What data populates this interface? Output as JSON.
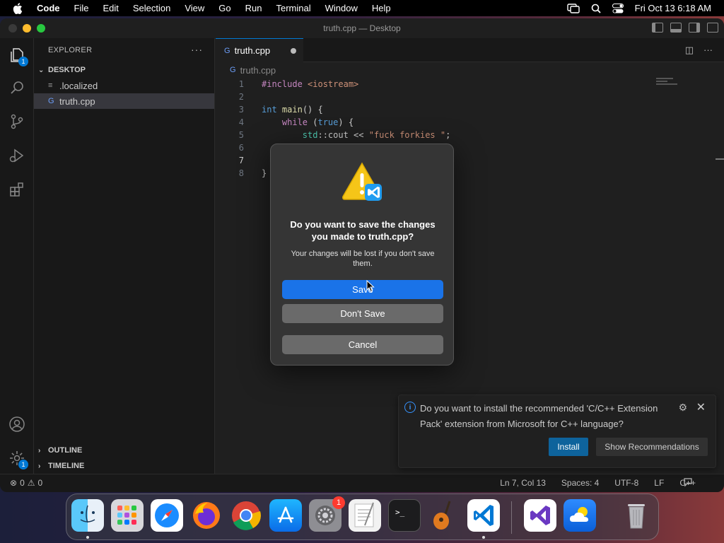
{
  "menubar": {
    "app_name": "Code",
    "items": [
      "File",
      "Edit",
      "Selection",
      "View",
      "Go",
      "Run",
      "Terminal",
      "Window",
      "Help"
    ],
    "clock": "Fri Oct 13  6:18 AM"
  },
  "window": {
    "title": "truth.cpp — Desktop"
  },
  "activity": {
    "explorer_badge": "1",
    "manage_badge": "1"
  },
  "sidebar": {
    "header": "EXPLORER",
    "folder": "DESKTOP",
    "files": [
      ".localized",
      "truth.cpp"
    ],
    "outline": "OUTLINE",
    "timeline": "TIMELINE"
  },
  "editor": {
    "tab_label": "truth.cpp",
    "breadcrumb": "truth.cpp",
    "lines": [
      {
        "n": "1",
        "code": "#include <iostream>"
      },
      {
        "n": "2",
        "code": ""
      },
      {
        "n": "3",
        "code": "int main() {"
      },
      {
        "n": "4",
        "code": "    while (true) {"
      },
      {
        "n": "5",
        "code": "        std::cout << \"fuck forkies \";"
      },
      {
        "n": "6",
        "code": ""
      },
      {
        "n": "7",
        "code": ""
      },
      {
        "n": "8",
        "code": "}"
      }
    ]
  },
  "dialog": {
    "title": "Do you want to save the changes you made to truth.cpp?",
    "subtitle": "Your changes will be lost if you don't save them.",
    "save": "Save",
    "dont_save": "Don't Save",
    "cancel": "Cancel"
  },
  "toast": {
    "message": "Do you want to install the recommended 'C/C++ Extension Pack' extension from Microsoft for C++ language?",
    "install": "Install",
    "show_recommendations": "Show Recommendations"
  },
  "statusbar": {
    "errors": "0",
    "warnings": "0",
    "position": "Ln 7, Col 13",
    "spaces": "Spaces: 4",
    "encoding": "UTF-8",
    "eol": "LF",
    "language": "C++"
  },
  "dock": {
    "system_settings_badge": "1"
  },
  "colors": {
    "accent": "#0078d4",
    "dialog_primary": "#1a73e8",
    "editor_bg": "#1f1f1f"
  }
}
